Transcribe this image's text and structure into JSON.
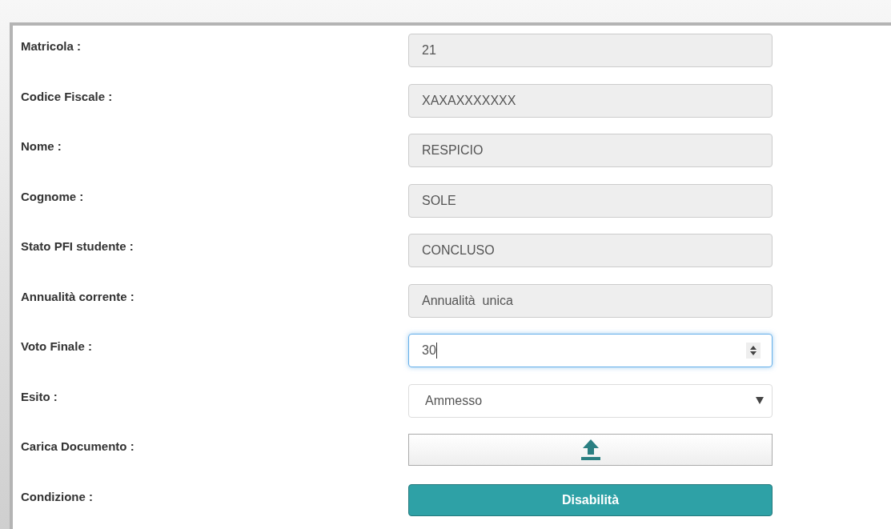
{
  "form": {
    "rows": [
      {
        "label": "Matricola :",
        "kind": "readonly",
        "value": "21"
      },
      {
        "label": "Codice Fiscale :",
        "kind": "readonly",
        "value": "XAXAXXXXXXX"
      },
      {
        "label": "Nome :",
        "kind": "readonly",
        "value": "RESPICIO"
      },
      {
        "label": "Cognome :",
        "kind": "readonly",
        "value": "SOLE"
      },
      {
        "label": "Stato PFI studente :",
        "kind": "readonly",
        "value": "CONCLUSO"
      },
      {
        "label": "Annualità corrente :",
        "kind": "readonly",
        "value": "Annualità  unica"
      },
      {
        "label": "Voto Finale :",
        "kind": "number",
        "value": "30",
        "focused": true
      },
      {
        "label": "Esito :",
        "kind": "select",
        "value": "Ammesso"
      },
      {
        "label": "Carica Documento :",
        "kind": "upload"
      },
      {
        "label": "Condizione :",
        "kind": "button",
        "value": "Disabilità"
      }
    ]
  }
}
